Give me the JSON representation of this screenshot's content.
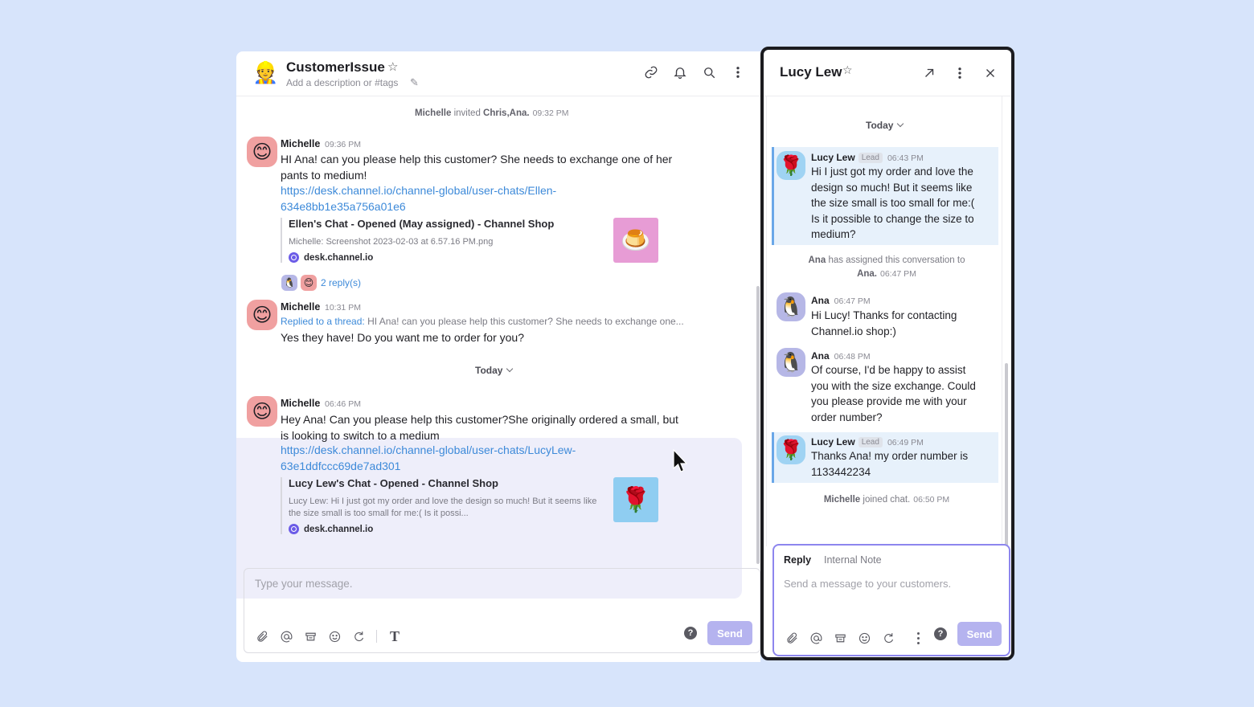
{
  "left": {
    "header": {
      "title": "CustomerIssue",
      "description": "Add a description or #tags",
      "group_emoji": "👷"
    },
    "system_invited": {
      "actor": "Michelle",
      "verb": "invited",
      "targets": "Chris,Ana.",
      "time": "09:32 PM"
    },
    "messages": [
      {
        "name": "Michelle",
        "time": "09:36 PM",
        "avatar_emoji": "😊",
        "text_line1": "HI Ana! can you please help this customer? She needs to exchange one of her",
        "text_line2": "pants to medium!",
        "link_line1": "https://desk.channel.io/channel-global/user-chats/Ellen-",
        "link_line2": "634e8bb1e35a756a01e6",
        "preview": {
          "title": "Ellen's Chat - Opened (May assigned) - Channel Shop",
          "subtitle": "Michelle: Screenshot 2023-02-03 at 6.57.16 PM.png",
          "domain": "desk.channel.io",
          "thumb_emoji": "🍮"
        },
        "replies": "2 reply(s)"
      },
      {
        "name": "Michelle",
        "time": "10:31 PM",
        "avatar_emoji": "😊",
        "replied_label": "Replied to a thread:",
        "replied_excerpt": "HI Ana! can you please help this customer? She needs to exchange one...",
        "text": "Yes they have! Do you want me to order for you?"
      },
      {
        "name": "Michelle",
        "time": "06:46 PM",
        "avatar_emoji": "😊",
        "text_line1": "Hey Ana! Can you please help this customer?She originally ordered a small, but",
        "text_line2": "is looking to switch to a medium",
        "link_line1": "https://desk.channel.io/channel-global/user-chats/LucyLew-",
        "link_line2": "63e1ddfccc69de7ad301",
        "preview": {
          "title": "Lucy Lew's Chat - Opened - Channel Shop",
          "subtitle_line1": "Lucy Lew: Hi I just got my order and love the design so much! But it seems like",
          "subtitle_line2": "the size small is too small for me:( Is it possi...",
          "domain": "desk.channel.io",
          "thumb_emoji": "🌹"
        }
      }
    ],
    "day_divider": "Today",
    "composer": {
      "placeholder": "Type your message.",
      "send_label": "Send",
      "help": "?"
    }
  },
  "right": {
    "header": {
      "title": "Lucy Lew"
    },
    "day_divider": "Today",
    "messages": [
      {
        "name": "Lucy Lew",
        "tag": "Lead",
        "time": "06:43 PM",
        "avatar_emoji": "🌹",
        "lines": [
          "Hi I just got my order and love the",
          "design so much! But it seems like",
          "the size small is too small for me:(",
          "Is it possible to change the size to",
          "medium?"
        ]
      },
      {
        "name": "Ana",
        "time": "06:47 PM",
        "avatar_emoji": "🐧",
        "lines": [
          "Hi Lucy! Thanks for contacting",
          "Channel.io shop:)"
        ]
      },
      {
        "name": "Ana",
        "time": "06:48 PM",
        "avatar_emoji": "🐧",
        "lines": [
          "Of course, I'd be happy to assist",
          "you with the size exchange. Could",
          "you please provide me with your",
          "order number?"
        ]
      },
      {
        "name": "Lucy Lew",
        "tag": "Lead",
        "time": "06:49 PM",
        "avatar_emoji": "🌹",
        "lines": [
          "Thanks Ana! my order number is",
          "1133442234"
        ]
      }
    ],
    "system_assigned": {
      "actor": "Ana",
      "text": "has assigned this conversation to",
      "target": "Ana.",
      "time": "06:47 PM"
    },
    "system_joined": {
      "actor": "Michelle",
      "text": "joined chat.",
      "time": "06:50 PM"
    },
    "composer": {
      "tab_reply": "Reply",
      "tab_note": "Internal Note",
      "placeholder": "Send a message to your customers.",
      "send_label": "Send",
      "help": "?"
    }
  },
  "colors": {
    "background": "#d7e4fb",
    "link": "#3d8ad9",
    "send_button": "#b5b3ef",
    "highlight": "#eeeefa",
    "lead_bubble": "#e7f1fb"
  }
}
